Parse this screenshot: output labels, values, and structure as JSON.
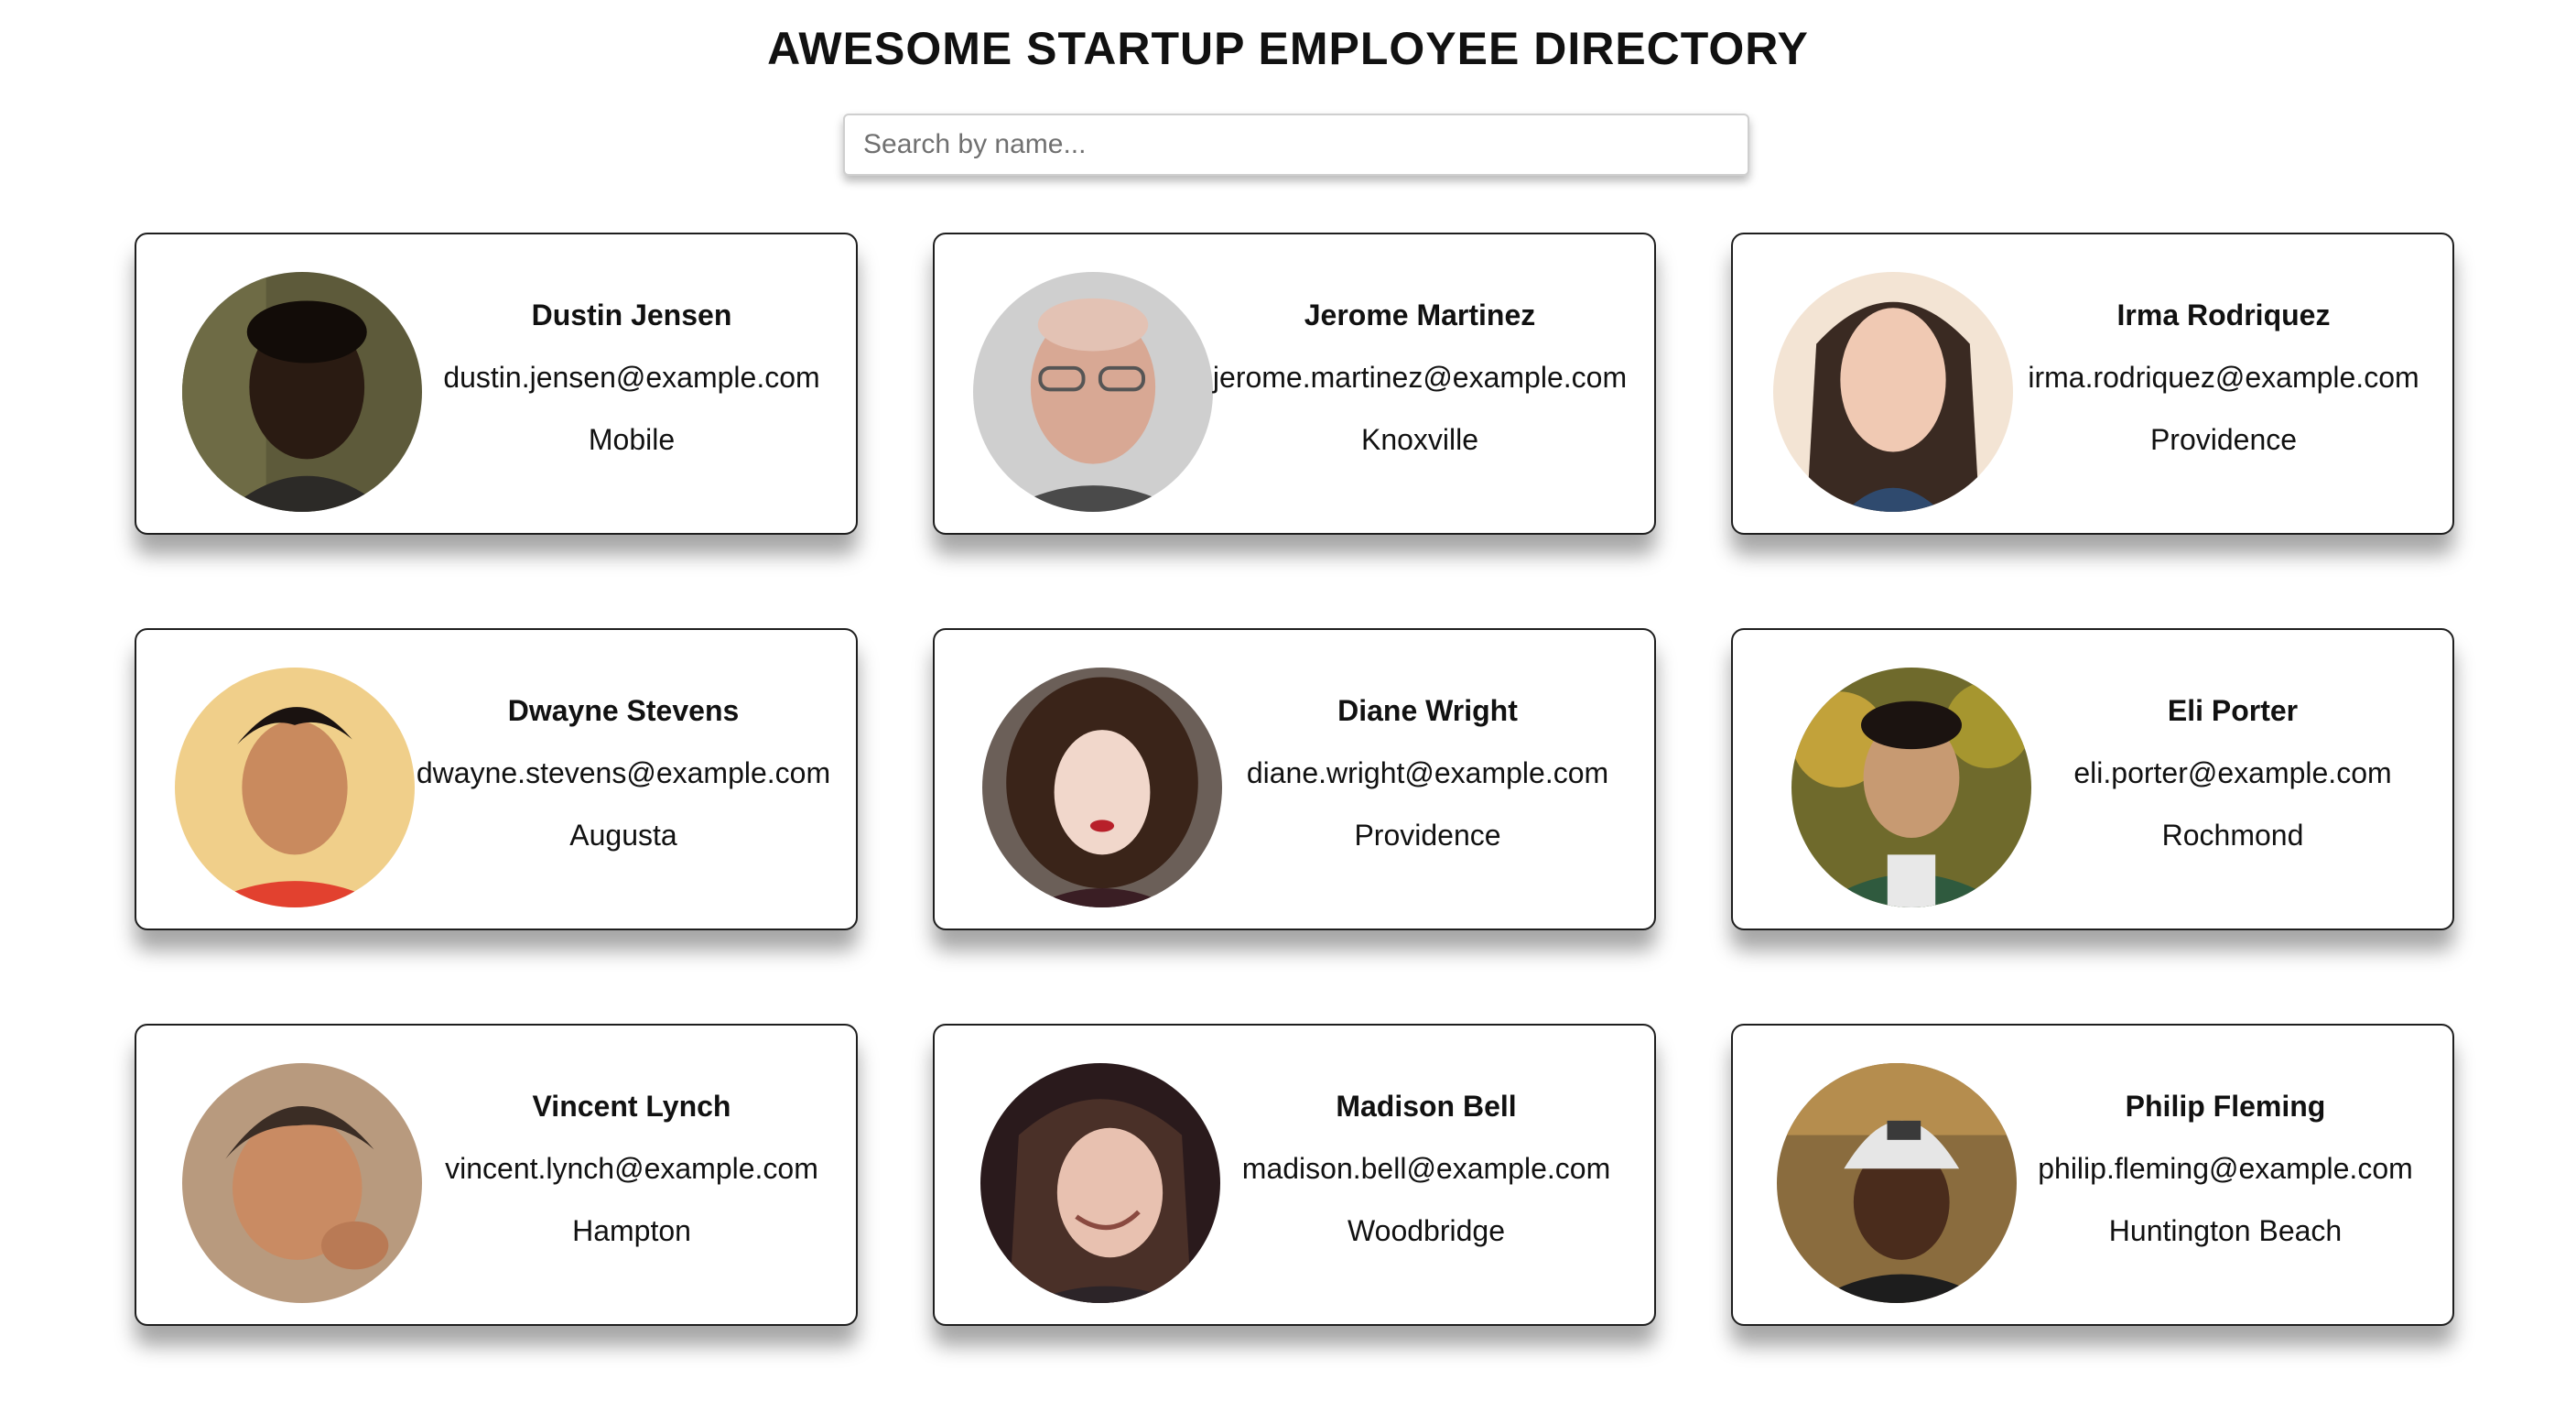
{
  "header": {
    "title": "AWESOME STARTUP EMPLOYEE DIRECTORY"
  },
  "search": {
    "placeholder": "Search by name...",
    "value": ""
  },
  "employees": [
    {
      "name": "Dustin Jensen",
      "email": "dustin.jensen@example.com",
      "city": "Mobile"
    },
    {
      "name": "Jerome Martinez",
      "email": "jerome.martinez@example.com",
      "city": "Knoxville"
    },
    {
      "name": "Irma Rodriquez",
      "email": "irma.rodriquez@example.com",
      "city": "Providence"
    },
    {
      "name": "Dwayne Stevens",
      "email": "dwayne.stevens@example.com",
      "city": "Augusta"
    },
    {
      "name": "Diane Wright",
      "email": "diane.wright@example.com",
      "city": "Providence"
    },
    {
      "name": "Eli Porter",
      "email": "eli.porter@example.com",
      "city": "Rochmond"
    },
    {
      "name": "Vincent Lynch",
      "email": "vincent.lynch@example.com",
      "city": "Hampton"
    },
    {
      "name": "Madison Bell",
      "email": "madison.bell@example.com",
      "city": "Woodbridge"
    },
    {
      "name": "Philip Fleming",
      "email": "philip.fleming@example.com",
      "city": "Huntington Beach"
    }
  ]
}
